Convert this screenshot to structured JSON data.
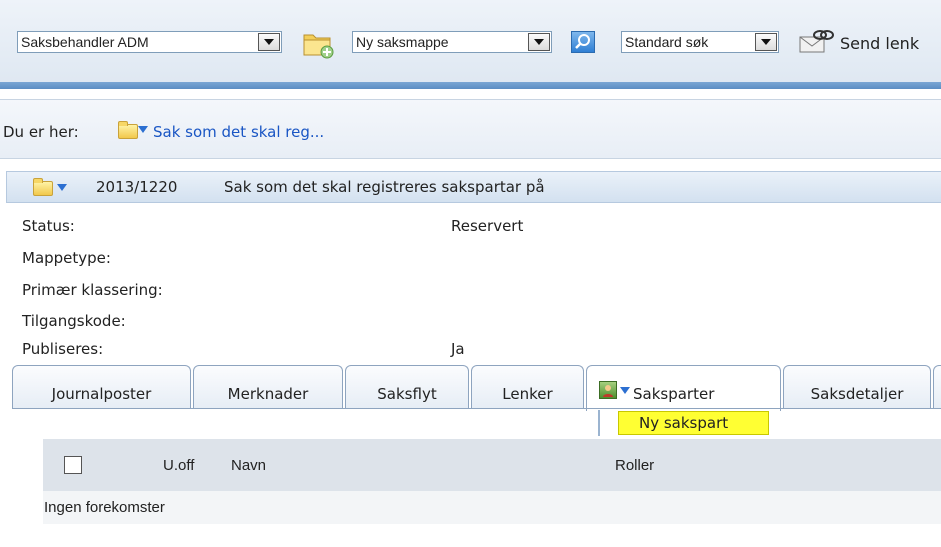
{
  "toolbar": {
    "user_select": "Saksbehandler ADM",
    "new_folder_select": "Ny saksmappe",
    "search_select": "Standard søk",
    "send_link_label": "Send lenk"
  },
  "breadcrumb": {
    "prefix": "Du er her:",
    "current": "Sak som det skal reg..."
  },
  "case": {
    "number": "2013/1220",
    "title": "Sak som det skal registreres sakspartar på",
    "fields": [
      {
        "label": "Status:",
        "value": "Reservert"
      },
      {
        "label": "Mappetype:",
        "value": ""
      },
      {
        "label": "Primær klassering:",
        "value": ""
      },
      {
        "label": "Tilgangskode:",
        "value": ""
      },
      {
        "label": "Publiseres:",
        "value": "Ja"
      }
    ]
  },
  "tabs": [
    {
      "label": "Journalposter"
    },
    {
      "label": "Merknader"
    },
    {
      "label": "Saksflyt"
    },
    {
      "label": "Lenker"
    },
    {
      "label": "Saksparter"
    },
    {
      "label": "Saksdetaljer"
    }
  ],
  "menu": {
    "new_party": "Ny sakspart"
  },
  "grid": {
    "columns": [
      "U.off",
      "Navn",
      "Roller"
    ],
    "empty_text": "Ingen forekomster"
  },
  "colors": {
    "accent_bar": "#5b8dc3",
    "highlight": "#ffff33",
    "link": "#1a56c4"
  }
}
